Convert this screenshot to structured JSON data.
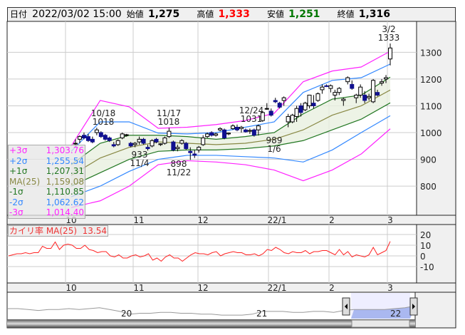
{
  "header": {
    "date_label": "日付",
    "date": "2022/03/02 15:00",
    "open_label": "始値",
    "open": "1,275",
    "high_label": "高値",
    "high": "1,333",
    "low_label": "安値",
    "low": "1,251",
    "close_label": "終値",
    "close": "1,316"
  },
  "colors": {
    "p3": "#ff22ff",
    "p2": "#3388ff",
    "p1": "#227722",
    "ma": "#888844",
    "up": "#ffffff",
    "down": "#101090",
    "osc": "#ff2222",
    "high": "#ff0000",
    "low": "#007700"
  },
  "legend": [
    {
      "name": "+3σ",
      "value": "1,303.76"
    },
    {
      "name": "+2σ",
      "value": "1,255.54"
    },
    {
      "name": "+1σ",
      "value": "1,207.31"
    },
    {
      "name": "MA(25)",
      "value": "1,159.08"
    },
    {
      "name": "-1σ",
      "value": "1,110.85"
    },
    {
      "name": "-2σ",
      "value": "1,062.62"
    },
    {
      "name": "-3σ",
      "value": "1,014.40"
    }
  ],
  "oscillator": {
    "label": "カイリ率 MA(25)",
    "value": "13.54"
  },
  "chart_data": {
    "type": "candlestick",
    "price_ticks": [
      "1300",
      "1200",
      "1100",
      "1000",
      "900",
      "800"
    ],
    "osc_ticks": [
      "20",
      "10",
      "0",
      "-10"
    ],
    "month_labels": [
      "10",
      "11",
      "12",
      "22/1",
      "2",
      "3"
    ],
    "annotations": [
      {
        "date": "10/18",
        "value": "1018"
      },
      {
        "date": "11/17",
        "value": "1018"
      },
      {
        "date": "12/24",
        "value": "1031"
      },
      {
        "date": "3/2",
        "value": "1333"
      },
      {
        "date": "11/4",
        "value": "933"
      },
      {
        "date": "11/22",
        "value": "898"
      },
      {
        "date": "1/6",
        "value": "989"
      }
    ],
    "bands": {
      "p3": [
        950,
        1120,
        1096,
        1016,
        1020,
        1030,
        1045,
        1072,
        1190,
        1230,
        1245,
        1304
      ],
      "p2": [
        930,
        1040,
        1040,
        998,
        995,
        1000,
        1020,
        1040,
        1150,
        1195,
        1205,
        1256
      ],
      "p1": [
        880,
        960,
        990,
        990,
        985,
        975,
        985,
        1000,
        1070,
        1125,
        1140,
        1207
      ],
      "ma": [
        840,
        905,
        945,
        965,
        960,
        955,
        960,
        975,
        1010,
        1065,
        1100,
        1159
      ],
      "m1": [
        800,
        850,
        900,
        930,
        935,
        935,
        940,
        950,
        970,
        1010,
        1050,
        1111
      ],
      "m2": [
        760,
        800,
        855,
        900,
        915,
        915,
        910,
        905,
        890,
        935,
        1000,
        1063
      ],
      "m3": [
        720,
        745,
        800,
        880,
        895,
        890,
        880,
        860,
        820,
        860,
        920,
        1014
      ]
    },
    "candles": [
      [
        960,
        975,
        945,
        960
      ],
      [
        975,
        990,
        960,
        985
      ],
      [
        990,
        1000,
        975,
        980
      ],
      [
        985,
        995,
        965,
        970
      ],
      [
        975,
        985,
        960,
        965
      ],
      [
        1000,
        1018,
        990,
        1010
      ],
      [
        1000,
        1005,
        980,
        985
      ],
      [
        990,
        995,
        970,
        975
      ],
      [
        980,
        985,
        965,
        970
      ],
      [
        955,
        965,
        945,
        950
      ],
      [
        955,
        975,
        950,
        970
      ],
      [
        980,
        1000,
        975,
        995
      ],
      [
        990,
        995,
        985,
        992
      ],
      [
        960,
        965,
        945,
        950
      ],
      [
        955,
        965,
        945,
        960
      ],
      [
        965,
        985,
        955,
        975
      ],
      [
        975,
        980,
        955,
        960
      ],
      [
        945,
        955,
        933,
        940
      ],
      [
        950,
        975,
        945,
        970
      ],
      [
        975,
        980,
        960,
        965
      ],
      [
        955,
        960,
        950,
        958
      ],
      [
        960,
        985,
        955,
        980
      ],
      [
        985,
        1018,
        980,
        1005
      ],
      [
        965,
        970,
        930,
        935
      ],
      [
        940,
        955,
        930,
        945
      ],
      [
        960,
        975,
        955,
        970
      ],
      [
        960,
        965,
        935,
        940
      ],
      [
        930,
        945,
        898,
        925
      ],
      [
        920,
        935,
        905,
        915
      ],
      [
        935,
        950,
        925,
        945
      ],
      [
        955,
        990,
        950,
        980
      ],
      [
        985,
        1000,
        980,
        995
      ],
      [
        1000,
        1005,
        985,
        990
      ],
      [
        990,
        1000,
        985,
        995
      ],
      [
        1010,
        1020,
        1005,
        1015
      ],
      [
        1010,
        1015,
        975,
        980
      ],
      [
        995,
        1000,
        990,
        998
      ],
      [
        1015,
        1031,
        1010,
        1025
      ],
      [
        1020,
        1030,
        1005,
        1010
      ],
      [
        1015,
        1025,
        1000,
        1020
      ],
      [
        1010,
        1015,
        1000,
        1003
      ],
      [
        1005,
        1015,
        995,
        1008
      ],
      [
        1010,
        1015,
        985,
        990
      ],
      [
        1010,
        1030,
        989,
        1025
      ],
      [
        1045,
        1080,
        1040,
        1075
      ],
      [
        1090,
        1110,
        1085,
        1090
      ],
      [
        1080,
        1090,
        1060,
        1065
      ],
      [
        1120,
        1130,
        1110,
        1115
      ],
      [
        1110,
        1115,
        1090,
        1095
      ],
      [
        1120,
        1135,
        1100,
        1130
      ],
      [
        1040,
        1070,
        1020,
        1060
      ],
      [
        1040,
        1070,
        1035,
        1065
      ],
      [
        1060,
        1100,
        1040,
        1090
      ],
      [
        1100,
        1110,
        1060,
        1075
      ],
      [
        1085,
        1115,
        1080,
        1110
      ],
      [
        1100,
        1140,
        1090,
        1140
      ],
      [
        1110,
        1140,
        1090,
        1100
      ],
      [
        1120,
        1150,
        1115,
        1145
      ],
      [
        1160,
        1180,
        1145,
        1170
      ],
      [
        1175,
        1180,
        1170,
        1172
      ],
      [
        1165,
        1180,
        1150,
        1175
      ],
      [
        1140,
        1160,
        1120,
        1150
      ],
      [
        1150,
        1170,
        1140,
        1165
      ],
      [
        1120,
        1130,
        1100,
        1125
      ],
      [
        1190,
        1210,
        1180,
        1205
      ],
      [
        1180,
        1195,
        1160,
        1165
      ],
      [
        1130,
        1145,
        1110,
        1140
      ],
      [
        1140,
        1180,
        1130,
        1170
      ],
      [
        1140,
        1155,
        1110,
        1120
      ],
      [
        1130,
        1145,
        1120,
        1135
      ],
      [
        1115,
        1200,
        1110,
        1195
      ],
      [
        1150,
        1160,
        1135,
        1140
      ],
      [
        1185,
        1200,
        1175,
        1190
      ],
      [
        1200,
        1215,
        1185,
        1205
      ],
      [
        1275,
        1333,
        1251,
        1316
      ]
    ],
    "oscillator_values": [
      0,
      1,
      2,
      2,
      3,
      2,
      3,
      3,
      9,
      7,
      7,
      13,
      6,
      10,
      11,
      10,
      7,
      7,
      10,
      6,
      5,
      3,
      4,
      4,
      0,
      -1,
      1,
      -2,
      -2,
      0,
      1,
      -1,
      0,
      2,
      -4,
      -2,
      -5,
      -1,
      1,
      -2,
      -2,
      -5,
      -2,
      1,
      3,
      2,
      2,
      1,
      3,
      4,
      0,
      2,
      3,
      4,
      3,
      3,
      1,
      1,
      2,
      0,
      2,
      6,
      5,
      8,
      6,
      3,
      2,
      4,
      3,
      3,
      5,
      2,
      4,
      4,
      5,
      5,
      3,
      1,
      6,
      1,
      4,
      -1,
      1,
      0,
      -1,
      1,
      8,
      1,
      3,
      5,
      13.54
    ],
    "navigator": {
      "labels": [
        "20",
        "21",
        "22"
      ],
      "values": [
        0,
        0,
        -1,
        -2,
        -1,
        -1,
        0,
        -1,
        0,
        1,
        -1,
        -3,
        -6,
        -5,
        -5,
        -4,
        -4,
        -5,
        -5,
        -6,
        -6,
        -7,
        -7,
        -7,
        -6,
        -3,
        -3,
        -3,
        -4,
        -4,
        -3,
        -3,
        -4,
        -2,
        -1,
        -1,
        -1,
        -1,
        0,
        1,
        3
      ]
    }
  }
}
